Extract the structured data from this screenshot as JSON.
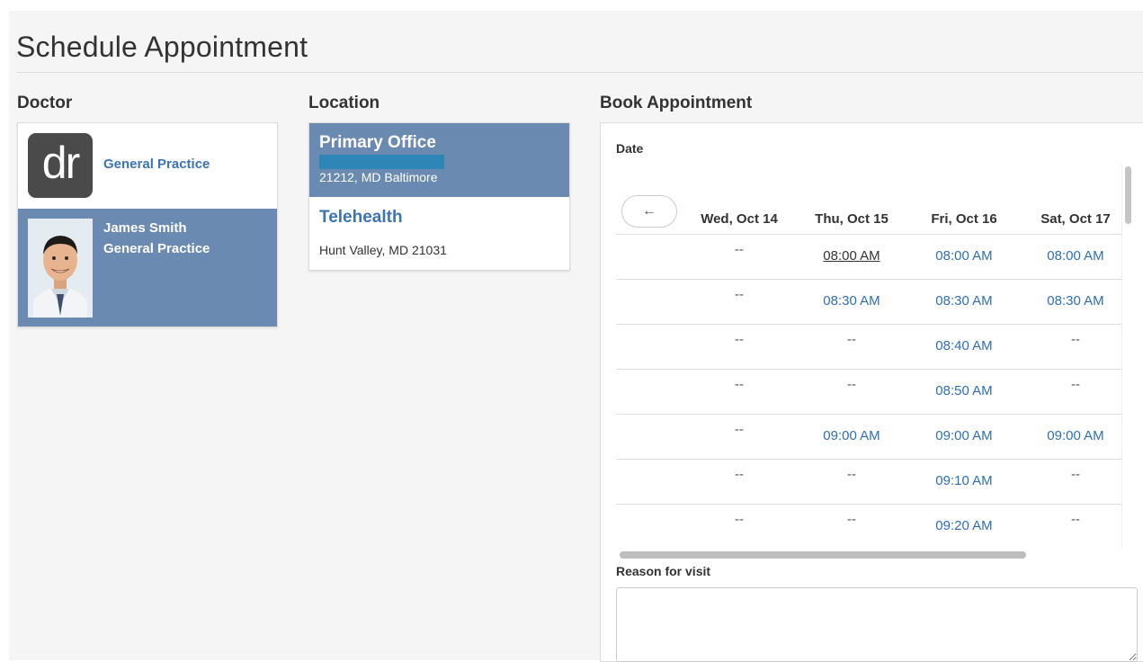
{
  "page": {
    "title": "Schedule Appointment"
  },
  "columns": {
    "doctor": "Doctor",
    "location": "Location",
    "book": "Book Appointment"
  },
  "doctor": {
    "practice_logo": "dr",
    "practice_label": "General Practice",
    "name": "James Smith",
    "specialty": "General Practice"
  },
  "locations": [
    {
      "name": "Primary Office",
      "address": "21212, MD Baltimore",
      "selected": true
    },
    {
      "name": "Telehealth",
      "address": "Hunt Valley, MD 21031",
      "selected": false
    }
  ],
  "booking": {
    "date_label": "Date",
    "prev_icon": "←",
    "days": [
      "Wed, Oct 14",
      "Thu, Oct 15",
      "Fri, Oct 16",
      "Sat, Oct 17"
    ],
    "rows": [
      [
        "--",
        "08:00 AM",
        "08:00 AM",
        "08:00 AM"
      ],
      [
        "--",
        "08:30 AM",
        "08:30 AM",
        "08:30 AM"
      ],
      [
        "--",
        "--",
        "08:40 AM",
        "--"
      ],
      [
        "--",
        "--",
        "08:50 AM",
        "--"
      ],
      [
        "--",
        "09:00 AM",
        "09:00 AM",
        "09:00 AM"
      ],
      [
        "--",
        "--",
        "09:10 AM",
        "--"
      ],
      [
        "--",
        "--",
        "09:20 AM",
        "--"
      ]
    ],
    "reason_label": "Reason for visit",
    "reason_value": "",
    "colors": {
      "slot": "#2f6fb6",
      "selected_bg": "#6b8ab1"
    }
  }
}
